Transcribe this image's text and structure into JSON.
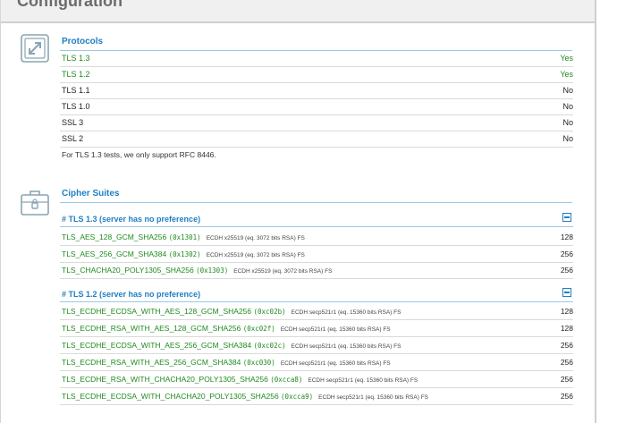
{
  "header": {
    "title": "Configuration"
  },
  "protocols": {
    "title": "Protocols",
    "rows": [
      {
        "name": "TLS 1.3",
        "value": "Yes"
      },
      {
        "name": "TLS 1.2",
        "value": "Yes"
      },
      {
        "name": "TLS 1.1",
        "value": "No"
      },
      {
        "name": "TLS 1.0",
        "value": "No"
      },
      {
        "name": "SSL 3",
        "value": "No"
      },
      {
        "name": "SSL 2",
        "value": "No"
      }
    ],
    "note": "For TLS 1.3 tests, we only support RFC 8446."
  },
  "cipher_suites": {
    "title": "Cipher Suites",
    "groups": [
      {
        "title": "# TLS 1.3 (server has no preference)",
        "rows": [
          {
            "suite": "TLS_AES_128_GCM_SHA256",
            "hex": "(0x1301)",
            "detail": "ECDH x25519 (eq. 3072 bits RSA)   FS",
            "bits": "128"
          },
          {
            "suite": "TLS_AES_256_GCM_SHA384",
            "hex": "(0x1302)",
            "detail": "ECDH x25519 (eq. 3072 bits RSA)   FS",
            "bits": "256"
          },
          {
            "suite": "TLS_CHACHA20_POLY1305_SHA256",
            "hex": "(0x1303)",
            "detail": "ECDH x25519 (eq. 3072 bits RSA)   FS",
            "bits": "256"
          }
        ]
      },
      {
        "title": "# TLS 1.2 (server has no preference)",
        "rows": [
          {
            "suite": "TLS_ECDHE_ECDSA_WITH_AES_128_GCM_SHA256",
            "hex": "(0xc02b)",
            "detail": "ECDH secp521r1 (eq. 15360 bits RSA)   FS",
            "bits": "128"
          },
          {
            "suite": "TLS_ECDHE_RSA_WITH_AES_128_GCM_SHA256",
            "hex": "(0xc02f)",
            "detail": "ECDH secp521r1 (eq. 15360 bits RSA)   FS",
            "bits": "128"
          },
          {
            "suite": "TLS_ECDHE_ECDSA_WITH_AES_256_GCM_SHA384",
            "hex": "(0xc02c)",
            "detail": "ECDH secp521r1 (eq. 15360 bits RSA)   FS",
            "bits": "256"
          },
          {
            "suite": "TLS_ECDHE_RSA_WITH_AES_256_GCM_SHA384",
            "hex": "(0xc030)",
            "detail": "ECDH secp521r1 (eq. 15360 bits RSA)   FS",
            "bits": "256"
          },
          {
            "suite": "TLS_ECDHE_RSA_WITH_CHACHA20_POLY1305_SHA256",
            "hex": "(0xcca8)",
            "detail": "ECDH secp521r1 (eq. 15360 bits RSA)   FS",
            "bits": "256"
          },
          {
            "suite": "TLS_ECDHE_ECDSA_WITH_CHACHA20_POLY1305_SHA256",
            "hex": "(0xcca9)",
            "detail": "ECDH secp521r1 (eq. 15360 bits RSA)   FS",
            "bits": "256"
          }
        ]
      }
    ]
  },
  "icons": {
    "protocols": "expand-arrows-icon",
    "ciphers": "locked-briefcase-icon",
    "collapse": "collapse-minus-icon"
  },
  "colors": {
    "accent": "#1f7fc1",
    "yes": "#1f8a1f",
    "suite": "#1f8a1f"
  }
}
